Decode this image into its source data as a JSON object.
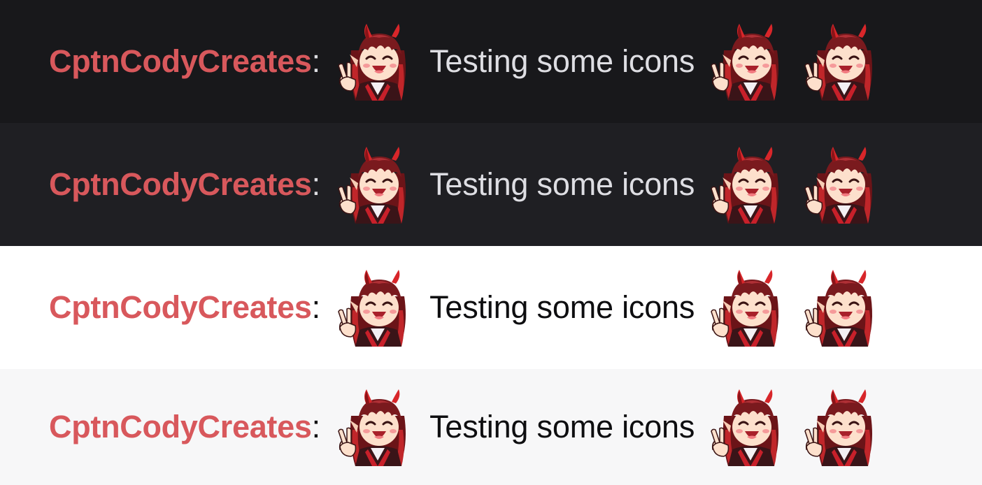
{
  "rows": [
    {
      "theme": "dark",
      "background": "#18181b",
      "text_color": "#dedee3"
    },
    {
      "theme": "dark-alt",
      "background": "#1f1f23",
      "text_color": "#dedee3"
    },
    {
      "theme": "light",
      "background": "#ffffff",
      "text_color": "#0e0e10"
    },
    {
      "theme": "light-alt",
      "background": "#f7f7f8",
      "text_color": "#0e0e10"
    }
  ],
  "message": {
    "username": "CptnCodyCreates",
    "username_color": "#d8585c",
    "separator": ":",
    "text": "Testing some icons",
    "emote_icon": "oni-girl-peace-sign-emote"
  }
}
